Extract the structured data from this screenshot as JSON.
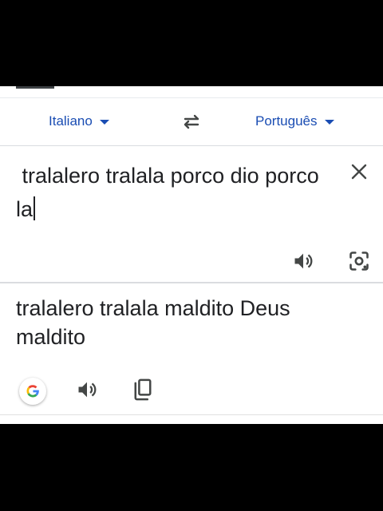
{
  "languages": {
    "source": "Italiano",
    "target": "Português"
  },
  "input": {
    "text": " tralalero tralala porco dio porco la"
  },
  "output": {
    "text": "tralalero tralala maldito Deus maldito"
  },
  "icons": {
    "swap": "swap-horiz-icon",
    "clear": "close-icon",
    "listen": "volume-up-icon",
    "camera": "google-lens-icon",
    "google": "google-logo-icon",
    "copy": "content-copy-icon"
  },
  "colors": {
    "accent": "#1a4db3",
    "text": "#202124",
    "icon": "#444746",
    "divider": "#dadce0"
  }
}
